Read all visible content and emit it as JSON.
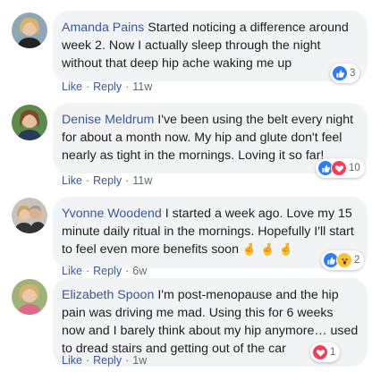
{
  "comments": [
    {
      "author": "Amanda Pains",
      "text": "Started noticing a difference around week 2. Now I actually sleep through the night without that deep hip ache waking me up",
      "like_label": "Like",
      "reply_label": "Reply",
      "time": "11w",
      "reaction_count": "3",
      "reactions": [
        "like"
      ]
    },
    {
      "author": "Denise Meldrum",
      "text": "I've been using the belt every night for about a month now. My hip and glute don't feel nearly as tight in the mornings. Loving it so far!",
      "like_label": "Like",
      "reply_label": "Reply",
      "time": "11w",
      "reaction_count": "10",
      "reactions": [
        "like",
        "love"
      ]
    },
    {
      "author": "Yvonne Woodend",
      "text": "I started a week ago. Love my 15 minute daily ritual in the mornings. Hopefully I'll start to feel even more benefits soon",
      "emoji": "🤞 🤞 🤞",
      "like_label": "Like",
      "reply_label": "Reply",
      "time": "6w",
      "reaction_count": "2",
      "reactions": [
        "like",
        "wow"
      ]
    },
    {
      "author": "Elizabeth Spoon",
      "text": "I'm post-menopause and the hip pain was driving me mad. Using this for 6 weeks now and I barely think about my hip anymore… used to dread stairs and getting out of the car",
      "like_label": "Like",
      "reply_label": "Reply",
      "time": "1w",
      "reaction_count": "1",
      "reactions": [
        "love"
      ]
    }
  ],
  "colors": {
    "author": "#385898",
    "bubble": "#f2f3f5",
    "like": "#2f7cf6",
    "love": "#f33e58",
    "wow": "#f7c23a"
  }
}
